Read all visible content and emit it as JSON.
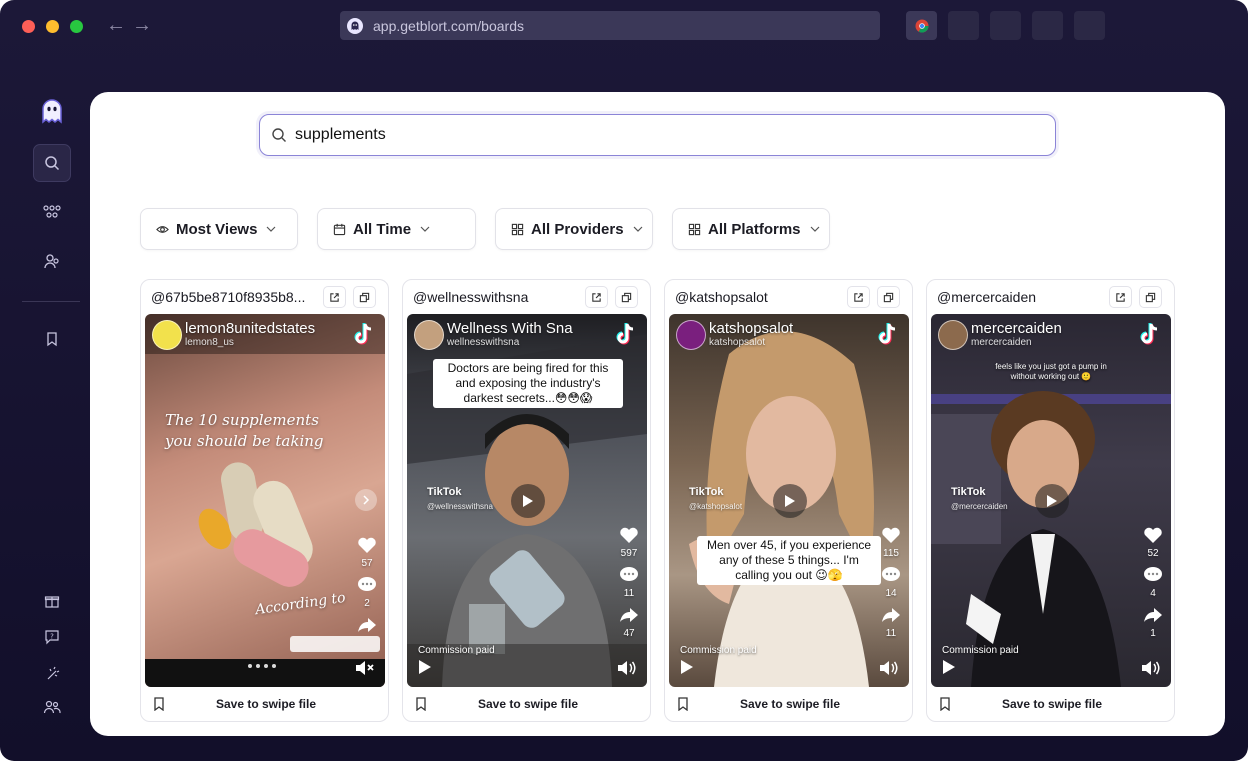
{
  "browser": {
    "url": "app.getblort.com/boards"
  },
  "search": {
    "value": "supplements"
  },
  "filters": [
    {
      "label": "Most Views",
      "icon": "eye-icon"
    },
    {
      "label": "All Time",
      "icon": "calendar-icon"
    },
    {
      "label": "All Providers",
      "icon": "grid-icon"
    },
    {
      "label": "All Platforms",
      "icon": "grid-icon"
    }
  ],
  "save_label": "Save to swipe file",
  "cards": [
    {
      "handle": "@67b5be8710f8935b8...",
      "video_name": "lemon8unitedstates",
      "video_sub": "lemon8_us",
      "overlay_text": "The 10 supplements you should be taking",
      "overlay_text_2": "According to",
      "likes": "57",
      "comments": "2",
      "colors": {
        "bg": "#b8796c",
        "accent": "#e8c94a"
      }
    },
    {
      "handle": "@wellnesswithsna",
      "video_name": "Wellness With Sna",
      "video_sub": "wellnesswithsna",
      "caption": "Doctors are being fired for this and exposing the industry's darkest secrets...😳😳😱",
      "watermark": "TikTok",
      "watermark_sub": "@wellnesswithsna",
      "likes": "597",
      "comments": "11",
      "shares": "47",
      "commission": "Commission paid",
      "colors": {
        "bg": "#4b4f55"
      }
    },
    {
      "handle": "@katshopsalot",
      "video_name": "katshopsalot",
      "video_sub": "katshopsalot",
      "caption": "Men over 45, if you experience any of these 5 things... I'm calling you out 😉🫣",
      "watermark": "TikTok",
      "watermark_sub": "@katshopsalot",
      "likes": "115",
      "comments": "14",
      "shares": "11",
      "commission": "Commission paid",
      "colors": {
        "bg": "#6e5a4a"
      }
    },
    {
      "handle": "@mercercaiden",
      "video_name": "mercercaiden",
      "video_sub": "mercercaiden",
      "caption": "feels like you just got a pump in without working out 🙂",
      "watermark": "TikTok",
      "watermark_sub": "@mercercaiden",
      "likes": "52",
      "comments": "4",
      "shares": "1",
      "commission": "Commission paid",
      "colors": {
        "bg": "#2f2d3a"
      }
    }
  ]
}
